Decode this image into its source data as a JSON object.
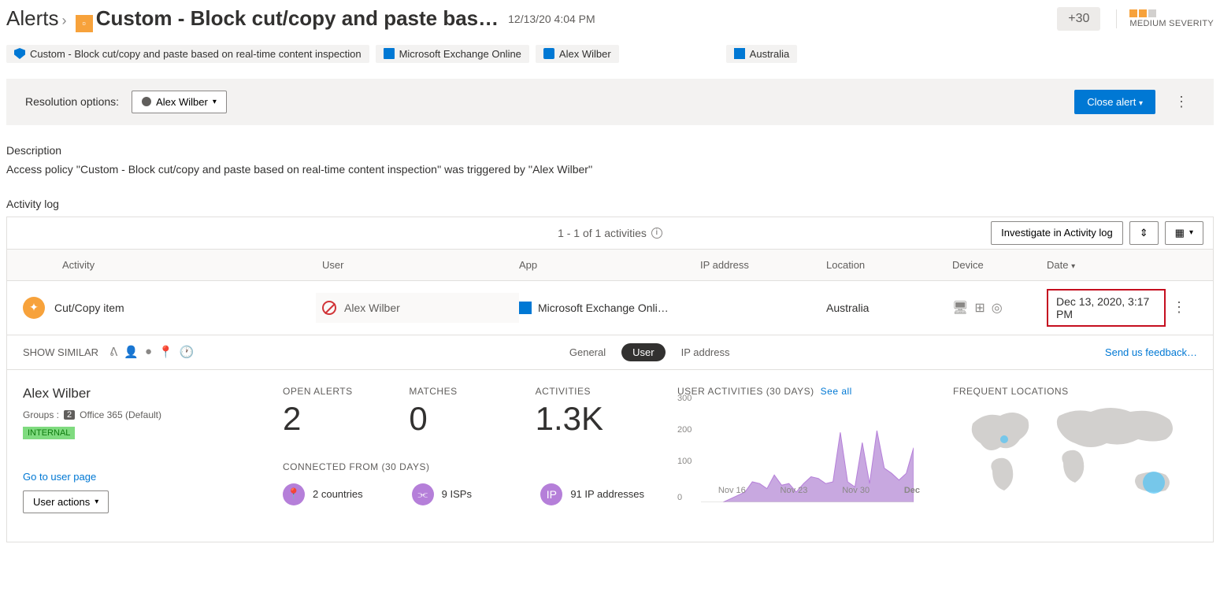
{
  "header": {
    "breadcrumb_root": "Alerts",
    "title": "Custom - Block cut/copy and paste bas…",
    "timestamp": "12/13/20 4:04 PM",
    "plus_badge": "+30",
    "severity_label": "MEDIUM SEVERITY"
  },
  "chips": {
    "policy": "Custom - Block cut/copy and paste based on real-time content inspection",
    "app": "Microsoft Exchange Online",
    "user": "Alex Wilber",
    "location": "Australia"
  },
  "resolution": {
    "label": "Resolution options:",
    "assignee": "Alex Wilber",
    "close_label": "Close alert"
  },
  "description": {
    "heading": "Description",
    "body": "Access policy ''Custom - Block cut/copy and paste based on real-time content inspection'' was triggered by ''Alex Wilber''"
  },
  "activity": {
    "heading": "Activity log",
    "count_text": "1 - 1 of 1 activities",
    "investigate_label": "Investigate in Activity log",
    "columns": {
      "activity": "Activity",
      "user": "User",
      "app": "App",
      "ip": "IP address",
      "location": "Location",
      "device": "Device",
      "date": "Date"
    },
    "row": {
      "activity": "Cut/Copy item",
      "user": "Alex Wilber",
      "app": "Microsoft Exchange Onli…",
      "ip": "",
      "location": "Australia",
      "date": "Dec 13, 2020, 3:17 PM"
    }
  },
  "subnav": {
    "show_similar": "SHOW SIMILAR",
    "tab_general": "General",
    "tab_user": "User",
    "tab_ip": "IP address",
    "feedback": "Send us feedback…"
  },
  "detail": {
    "user_name": "Alex Wilber",
    "groups_label": "Groups :",
    "groups_count": "2",
    "groups_list": "Office 365 (Default)",
    "internal": "INTERNAL",
    "user_page_link": "Go to user page",
    "user_actions": "User actions",
    "stats": {
      "open_alerts_label": "OPEN ALERTS",
      "open_alerts_value": "2",
      "matches_label": "MATCHES",
      "matches_value": "0",
      "activities_label": "ACTIVITIES",
      "activities_value": "1.3K"
    },
    "connected_label": "CONNECTED FROM (30 DAYS)",
    "connected": {
      "countries": "2 countries",
      "isps": "9 ISPs",
      "ips": "91 IP addresses"
    },
    "chart_label": "USER ACTIVITIES (30 DAYS)",
    "see_all": "See all",
    "freq_loc_label": "FREQUENT LOCATIONS"
  },
  "chart_data": {
    "type": "area",
    "title": "USER ACTIVITIES (30 DAYS)",
    "xlabel": "",
    "ylabel": "",
    "ylim": [
      0,
      300
    ],
    "y_ticks": [
      "0",
      "100",
      "200",
      "300"
    ],
    "categories": [
      "Nov 16",
      "Nov 23",
      "Nov 30",
      "Dec"
    ],
    "values": [
      0,
      0,
      0,
      0,
      10,
      20,
      30,
      60,
      55,
      40,
      80,
      50,
      55,
      30,
      55,
      75,
      70,
      55,
      60,
      205,
      60,
      45,
      175,
      55,
      210,
      100,
      85,
      65,
      85,
      160
    ]
  }
}
